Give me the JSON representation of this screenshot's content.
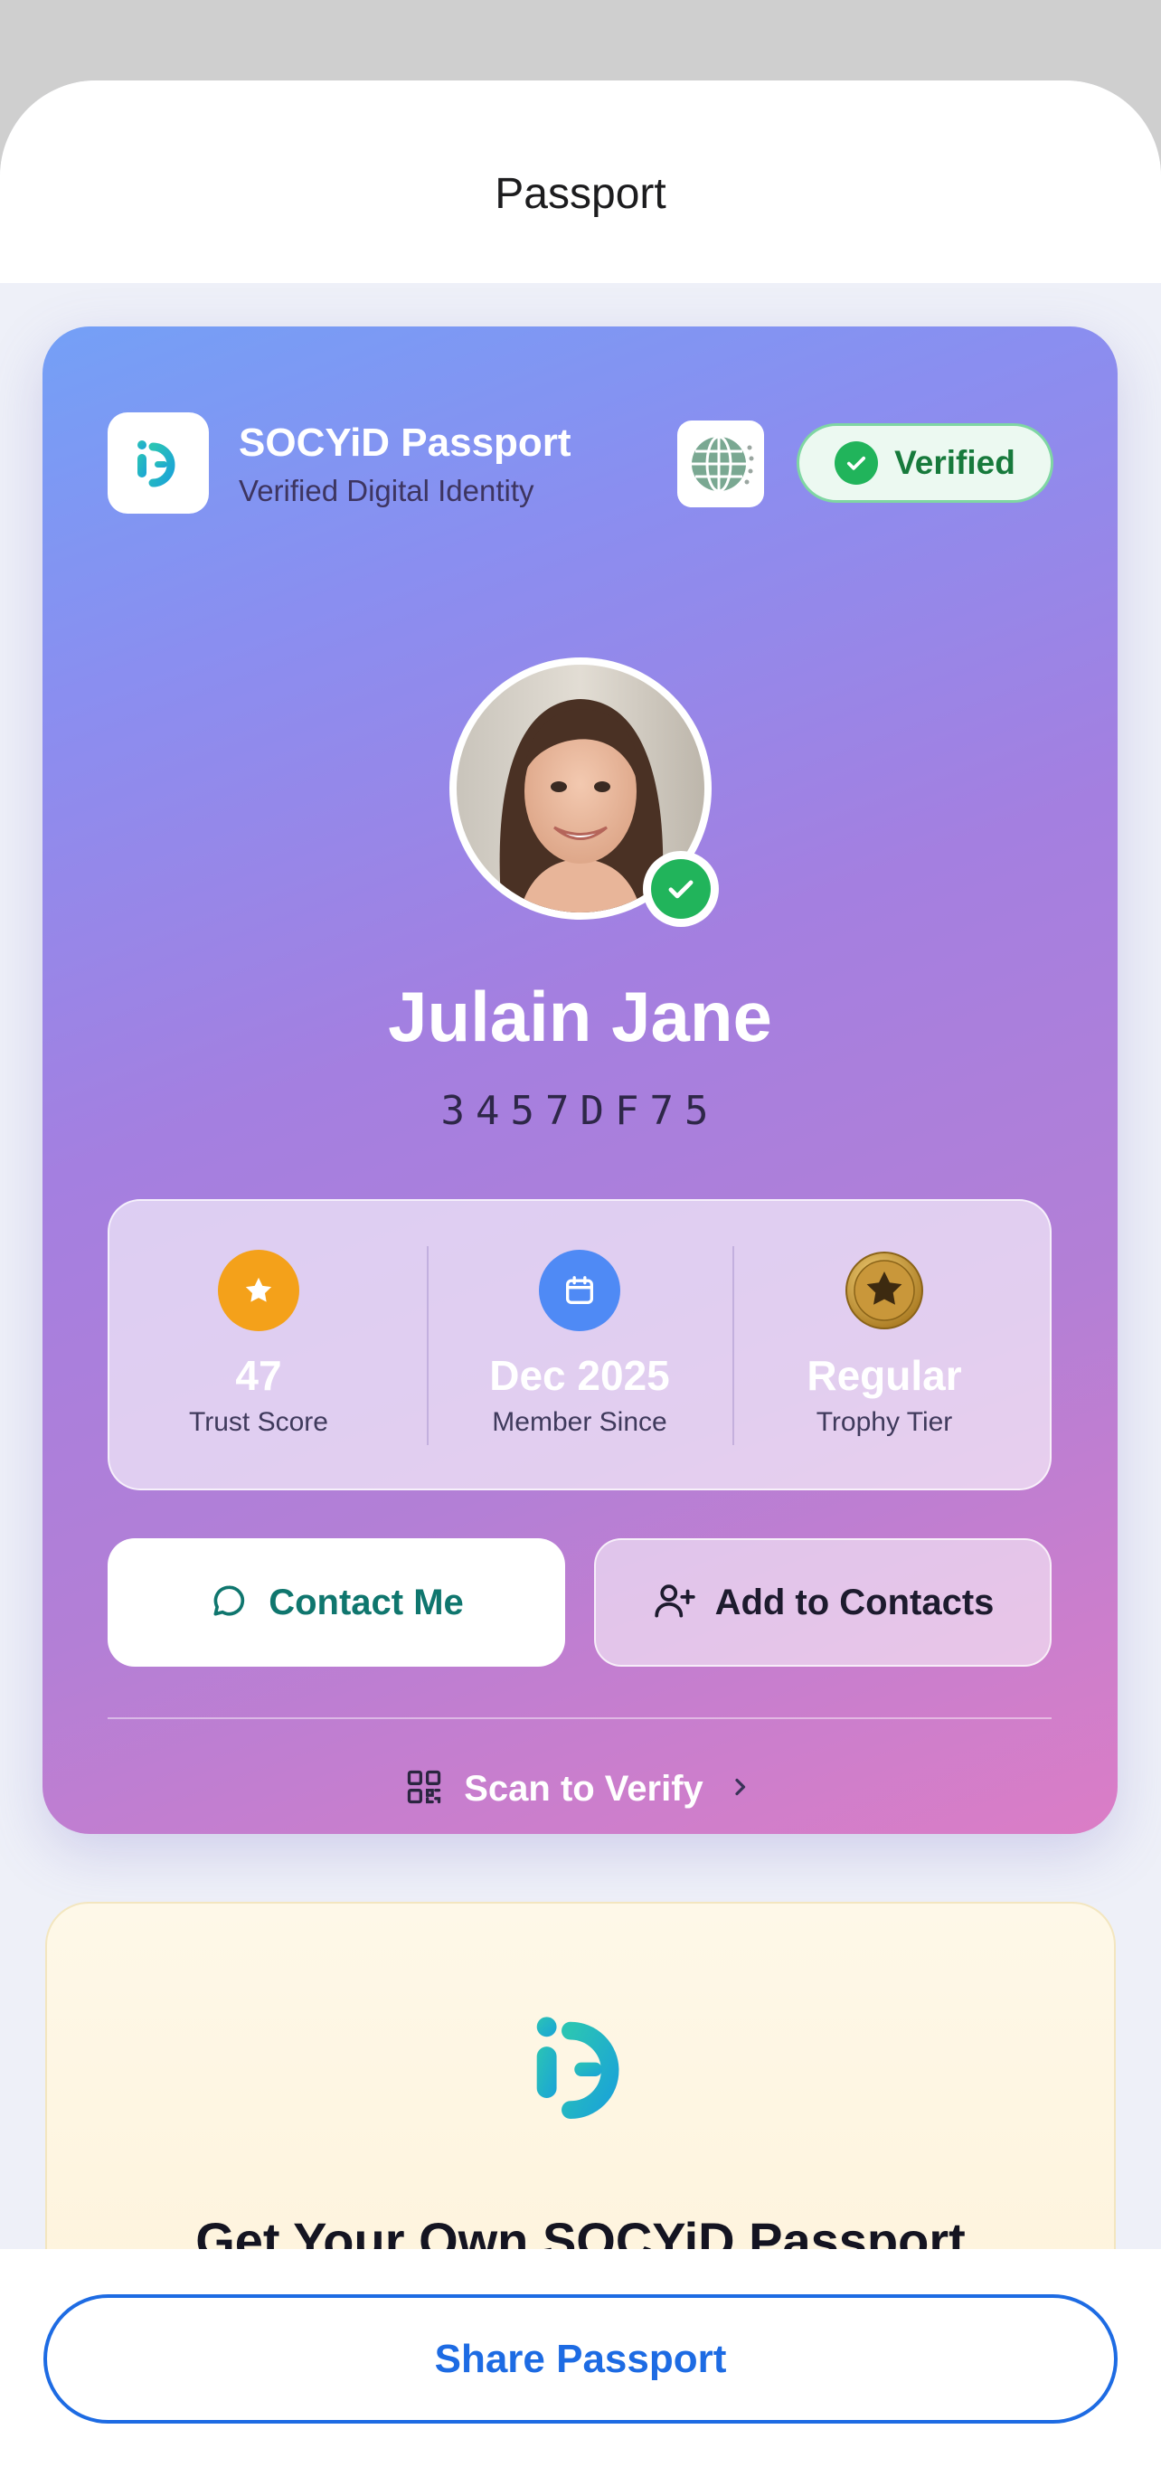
{
  "header": {
    "title": "Passport"
  },
  "card": {
    "brand_name": "SOCYiD Passport",
    "brand_subtitle": "Verified Digital Identity",
    "verified_label": "Verified",
    "person_name": "Julain Jane",
    "person_id": "3457DF75",
    "stats": [
      {
        "icon": "star-icon",
        "value": "47",
        "label": "Trust Score",
        "color": "#f4a11a"
      },
      {
        "icon": "calendar-icon",
        "value": "Dec 2025",
        "label": "Member Since",
        "color": "#4f8af5"
      },
      {
        "icon": "medal-icon",
        "value": "Regular",
        "label": "Trophy Tier",
        "color": "#b8862b"
      }
    ],
    "contact_label": "Contact Me",
    "add_contacts_label": "Add to Contacts",
    "scan_label": "Scan to Verify"
  },
  "promo": {
    "title": "Get Your Own SOCYiD Passport"
  },
  "footer": {
    "share_label": "Share Passport"
  },
  "colors": {
    "accent_teal": "#0f766e",
    "verified_green": "#21b45b",
    "share_blue": "#1d6be3"
  }
}
